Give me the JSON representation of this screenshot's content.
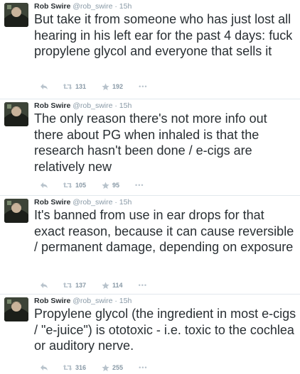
{
  "tweets": [
    {
      "name": "Rob Swire",
      "handle": "@rob_swire",
      "time": "15h",
      "text": "But take it from someone who has just lost all hearing in his left ear for the past 4 days: fuck propylene glycol and everyone that sells it",
      "retweets": "131",
      "favorites": "192"
    },
    {
      "name": "Rob Swire",
      "handle": "@rob_swire",
      "time": "15h",
      "text": "The only reason there's not more info out there about PG when inhaled is that the research hasn't been done / e-cigs are relatively new",
      "retweets": "105",
      "favorites": "95"
    },
    {
      "name": "Rob Swire",
      "handle": "@rob_swire",
      "time": "15h",
      "text": "It's banned from use in ear drops for that exact reason, because it can cause reversible / permanent damage, depending on exposure",
      "retweets": "137",
      "favorites": "114"
    },
    {
      "name": "Rob Swire",
      "handle": "@rob_swire",
      "time": "15h",
      "text": "Propylene glycol (the ingredient in most e-cigs / \"e-juice\") is ototoxic - i.e. toxic to the cochlea or auditory nerve.",
      "retweets": "316",
      "favorites": "255"
    }
  ],
  "separator": "·",
  "more_label": "•••",
  "icons": {
    "reply": "reply-icon",
    "retweet": "retweet-icon",
    "favorite": "star-icon",
    "more": "more-icon"
  },
  "colors": {
    "text": "#292f33",
    "meta": "#8899a6",
    "divider": "#e1e8ed"
  }
}
